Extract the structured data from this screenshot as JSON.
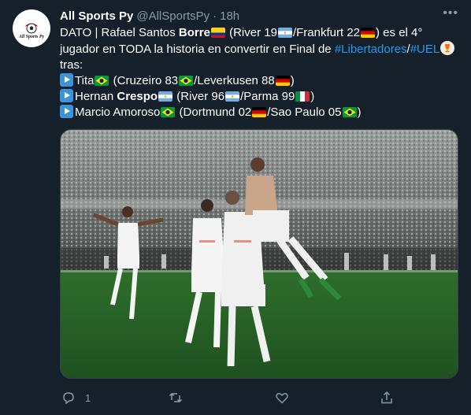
{
  "tweet": {
    "author": {
      "name": "All Sports Py",
      "handle": "@AllSportsPy",
      "separator": "·",
      "time": "18h",
      "avatar_text": "All Sports Py"
    },
    "more_icon": "more-horizontal-icon",
    "body": {
      "l1_pre": "DATO | Rafael Santos ",
      "l1_bold": "Borre",
      "l1_mid": " (River 19",
      "l1_mid2": "/Frankfurt 22",
      "l1_post": ") es el 4°",
      "l2_pre": "jugador en TODA la historia en convertir en Final de ",
      "l2_tag1": "#Libertadores",
      "l2_slash": "/",
      "l2_tag2": "#UEL",
      "l3": "tras:",
      "l4_pre": "Tita",
      "l4_mid": " (Cruzeiro 83",
      "l4_mid2": "/Leverkusen 88",
      "l4_post": ")",
      "l5_pre": "Hernan ",
      "l5_bold": "Crespo",
      "l5_mid": " (River 96",
      "l5_mid2": "/Parma 99",
      "l5_post": ")",
      "l6_pre": "Marcio Amoroso",
      "l6_mid": " (Dortmund 02",
      "l6_mid2": "/Sao Paulo 05",
      "l6_post": ")"
    },
    "flags": [
      "colombia",
      "argentina",
      "germany",
      "brazil",
      "italy"
    ],
    "actions": {
      "reply_count": "1",
      "retweet_count": "",
      "like_count": "",
      "share_count": ""
    },
    "colors": {
      "background": "#15202b",
      "text": "#ffffff",
      "secondary": "#8b98a5",
      "link": "#1d9bf0"
    }
  }
}
